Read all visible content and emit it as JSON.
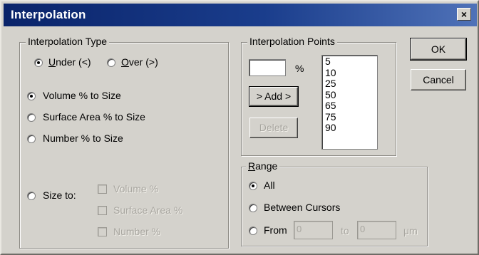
{
  "window": {
    "title": "Interpolation",
    "close_glyph": "×"
  },
  "interp_type": {
    "legend": "Interpolation Type",
    "under": {
      "label": "Under (<)",
      "selected": true
    },
    "over": {
      "label": "Over (>)",
      "selected": false
    },
    "options": [
      {
        "label": "Volume % to Size",
        "selected": true
      },
      {
        "label": "Surface Area % to Size",
        "selected": false
      },
      {
        "label": "Number % to Size",
        "selected": false
      }
    ],
    "size_to": {
      "label": "Size to:",
      "selected": false
    },
    "size_to_checks": [
      {
        "label": "Volume %"
      },
      {
        "label": "Surface Area %"
      },
      {
        "label": "Number %"
      }
    ]
  },
  "interp_points": {
    "legend": "Interpolation Points",
    "input_value": "",
    "unit": "%",
    "add_label": "> Add >",
    "delete_label": "Delete",
    "items": [
      "5",
      "10",
      "25",
      "50",
      "65",
      "75",
      "90"
    ]
  },
  "range": {
    "legend": "Range",
    "all": {
      "label": "All",
      "selected": true
    },
    "between": {
      "label": "Between Cursors",
      "selected": false
    },
    "from": {
      "label": "From",
      "selected": false
    },
    "from_value": "0",
    "to_label": "to",
    "to_value": "0",
    "unit": "μm"
  },
  "buttons": {
    "ok": "OK",
    "cancel": "Cancel"
  }
}
